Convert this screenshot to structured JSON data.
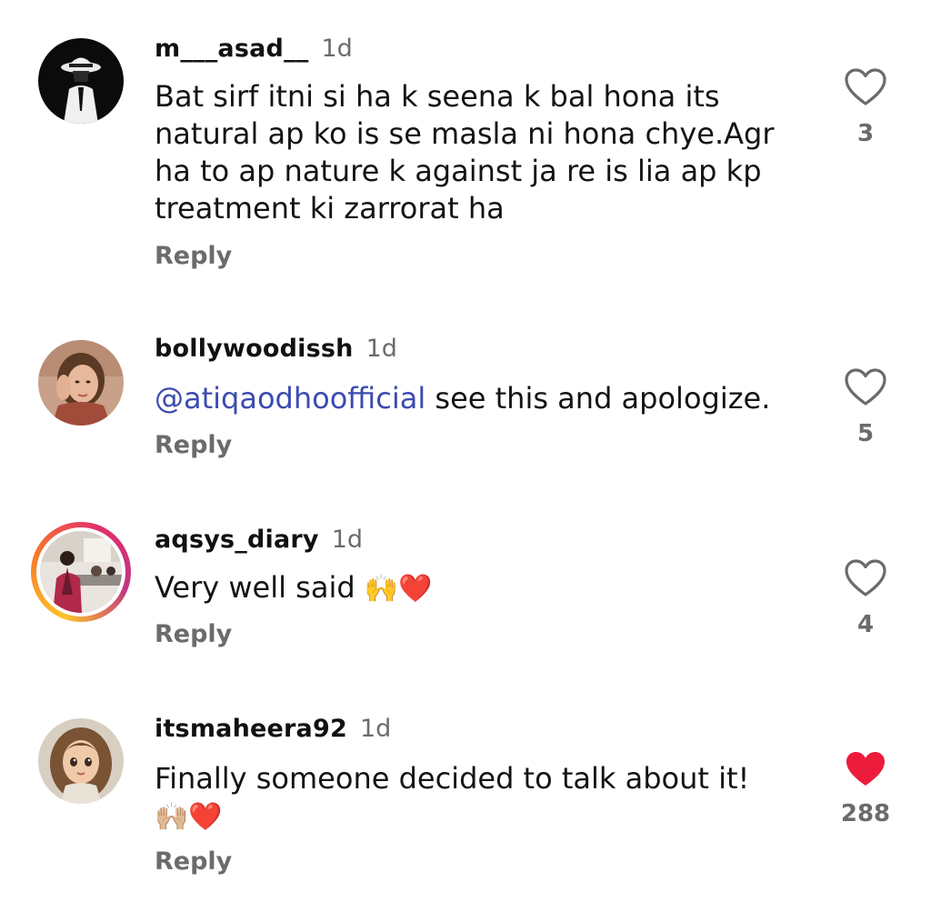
{
  "comments": [
    {
      "username": "m___asad__",
      "time": "1d",
      "text": "Bat sirf itni si ha k seena k bal hona its natural ap ko is se masla ni hona chye.Agr ha to ap nature k against ja re is lia ap kp treatment ki zarrorat ha",
      "reply_label": "Reply",
      "likes": "3",
      "liked": false
    },
    {
      "username": "bollywoodissh",
      "time": "1d",
      "mention": "@atiqaodhoofficial",
      "text": " see this and apologize.",
      "reply_label": "Reply",
      "likes": "5",
      "liked": false
    },
    {
      "username": "aqsys_diary",
      "time": "1d",
      "text": "Very well said ",
      "emoji": "🙌❤️",
      "reply_label": "Reply",
      "likes": "4",
      "liked": false
    },
    {
      "username": "itsmaheera92",
      "time": "1d",
      "text": "Finally someone decided to talk about it!",
      "emoji": "🙌🏼❤️",
      "reply_label": "Reply",
      "likes": "288",
      "liked": true
    }
  ],
  "colors": {
    "like_active": "#ed1c3c",
    "mention": "#3b4bb0",
    "muted": "#6b6b6b"
  },
  "icons": {
    "like": "heart-outline-icon",
    "liked": "heart-filled-icon"
  }
}
